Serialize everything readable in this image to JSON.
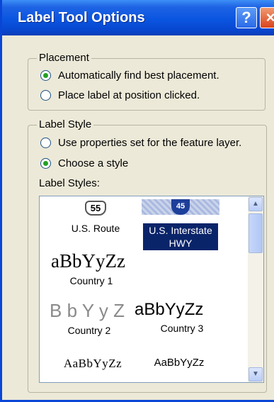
{
  "window": {
    "title": "Label Tool Options",
    "help_glyph": "?",
    "close_glyph": "×"
  },
  "placement": {
    "legend": "Placement",
    "options": [
      {
        "label": "Automatically find best placement.",
        "checked": true
      },
      {
        "label": "Place label at position clicked.",
        "checked": false
      }
    ]
  },
  "label_style": {
    "legend": "Label Style",
    "options": [
      {
        "label": "Use properties set for the feature layer.",
        "checked": false
      },
      {
        "label": "Choose a style",
        "checked": true
      }
    ],
    "styles_label": "Label Styles:"
  },
  "styles_list": {
    "items": [
      {
        "preview": "55",
        "name": "U.S. Route",
        "selected": false
      },
      {
        "preview": "45",
        "name": "U.S. Interstate HWY",
        "selected": true
      },
      {
        "preview": "aBbYyZz",
        "name": "Country 1",
        "selected": false
      },
      {
        "preview": "B b Y y Z",
        "name": "Country 2",
        "selected": false
      },
      {
        "preview": "aBbYyZz",
        "name": "Country 3",
        "selected": false
      },
      {
        "preview": "AaBbYyZz",
        "name": "",
        "selected": false
      },
      {
        "preview": "AaBbYyZz",
        "name": "",
        "selected": false
      }
    ],
    "scroll_up_glyph": "▲",
    "scroll_down_glyph": "▼"
  },
  "colors": {
    "titlebar": "#0a55e0",
    "dialog_bg": "#ece9d8",
    "selection": "#0a246a",
    "radio_dot": "#21a121"
  }
}
